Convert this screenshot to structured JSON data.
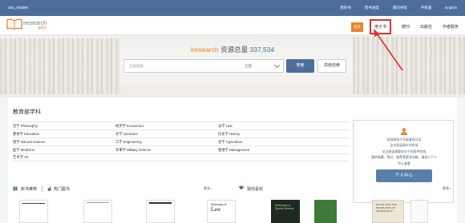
{
  "topbar": {
    "user": "sxu_reader",
    "links": [
      "我的书",
      "借书进度",
      "我的书架",
      "手机版",
      "English"
    ]
  },
  "header": {
    "logo_text": "iresearch",
    "logo_sub": "爱研究",
    "home_label": "首页",
    "nav": [
      "电子书",
      "期刊",
      "出版社",
      "作者服务"
    ],
    "active_nav": "电子书"
  },
  "banner": {
    "brand": "iresearch",
    "title_label": "资源总量",
    "count": "337,534",
    "search_placeholder": "全站搜索",
    "search_scope": "全部",
    "search_button": "搜索",
    "advanced_button": "高级检索"
  },
  "subjects": {
    "title": "教育部学科",
    "rows": [
      [
        "哲学 Philosophy",
        "经济学 Economics",
        "法学 Law"
      ],
      [
        "教育学 Education",
        "文学 Literature",
        "历史学 History"
      ],
      [
        "理学 Natural Science",
        "工学 Engineering",
        "农学 Agriculture"
      ],
      [
        "医学 Medicine",
        "军事学 Military Science",
        "管理学 Management"
      ],
      [
        "艺术学 Art",
        "",
        ""
      ]
    ]
  },
  "side_card": {
    "line1_prefix": "欢迎阅电子书读者的",
    "line1_link": "试读",
    "line2_prefix": "全文阅读请",
    "line2_link": "在线申请",
    "line3_prefix": "论文阅读需要在",
    "line3_link": "电子档案",
    "line3_suffix": "中完成",
    "line4": "我的收藏、笔记、推荐等更多功能，请进入个人",
    "line5": "中心查看",
    "button": "个人中心"
  },
  "lower": {
    "new_books": "新书推荐",
    "hot_books": "热门图书",
    "more_left": "更多>",
    "guess": "猜你喜欢",
    "more_right": "更多>"
  },
  "covers": {
    "c4_title": "Dictionary of",
    "c4_big": "Law",
    "c5_title": "Dictionary of Sports Science",
    "c7_title": "FAITH AND THE PROBLEMS OF MODERNITY"
  },
  "colors": {
    "topbar": "#4d6e9a",
    "accent": "#e8842d",
    "primary_button": "#4f6f9b",
    "highlight": "#e03030"
  }
}
